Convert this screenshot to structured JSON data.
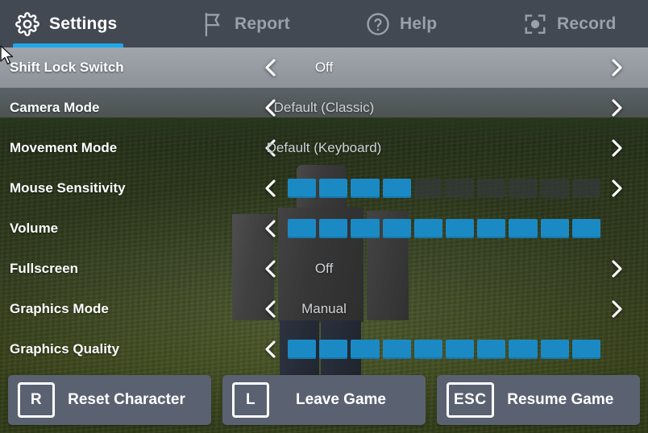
{
  "tabs": [
    {
      "label": "Settings",
      "icon": "gear-icon",
      "active": true
    },
    {
      "label": "Report",
      "icon": "flag-icon",
      "active": false
    },
    {
      "label": "Help",
      "icon": "question-circle-icon",
      "active": false
    },
    {
      "label": "Record",
      "icon": "record-icon",
      "active": false
    }
  ],
  "settings": [
    {
      "label": "Shift Lock Switch",
      "type": "option",
      "value": "Off",
      "selected": true,
      "left_arrow": true,
      "right_arrow": true
    },
    {
      "label": "Camera Mode",
      "type": "option",
      "value": "Default (Classic)",
      "selected": false,
      "left_arrow": true,
      "right_arrow": true
    },
    {
      "label": "Movement Mode",
      "type": "option",
      "value": "Default (Keyboard)",
      "selected": false,
      "left_arrow": true,
      "right_arrow": true
    },
    {
      "label": "Mouse Sensitivity",
      "type": "slider",
      "filled": 4,
      "total": 10,
      "selected": false,
      "left_arrow": true,
      "right_arrow": true
    },
    {
      "label": "Volume",
      "type": "slider",
      "filled": 10,
      "total": 10,
      "selected": false,
      "left_arrow": true,
      "right_arrow": false
    },
    {
      "label": "Fullscreen",
      "type": "option",
      "value": "Off",
      "selected": false,
      "left_arrow": true,
      "right_arrow": true
    },
    {
      "label": "Graphics Mode",
      "type": "option",
      "value": "Manual",
      "selected": false,
      "left_arrow": true,
      "right_arrow": true
    },
    {
      "label": "Graphics Quality",
      "type": "slider",
      "filled": 10,
      "total": 10,
      "selected": false,
      "left_arrow": true,
      "right_arrow": false
    }
  ],
  "actions": [
    {
      "key": "R",
      "label": "Reset Character"
    },
    {
      "key": "L",
      "label": "Leave Game"
    },
    {
      "key": "ESC",
      "label": "Resume Game"
    }
  ],
  "colors": {
    "accent": "#1ca9eb",
    "slider_fill": "#1b8ac4",
    "slider_empty": "#343a3c",
    "header_bg": "#424953",
    "button_bg": "#5a6271",
    "label_text": "#ffffff",
    "value_text": "#cfd3d6"
  }
}
